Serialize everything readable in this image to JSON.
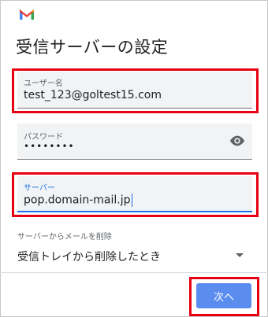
{
  "app": {
    "logo_icon": "gmail-logo-icon"
  },
  "page": {
    "title": "受信サーバーの設定"
  },
  "fields": {
    "username": {
      "label": "ユーザー名",
      "value": "test_123@goltest15.com"
    },
    "password": {
      "label": "パスワード",
      "value": "••••••••",
      "toggle_icon": "eye-icon"
    },
    "server": {
      "label": "サーバー",
      "value": "pop.domain-mail.jp"
    }
  },
  "delete_option": {
    "label": "サーバーからメールを削除",
    "selected": "受信トレイから削除したとき",
    "icon": "dropdown-arrow-icon"
  },
  "actions": {
    "next_label": "次へ"
  },
  "colors": {
    "highlight": "#e60012",
    "accent": "#1a73e8",
    "button": "#5b8def"
  }
}
